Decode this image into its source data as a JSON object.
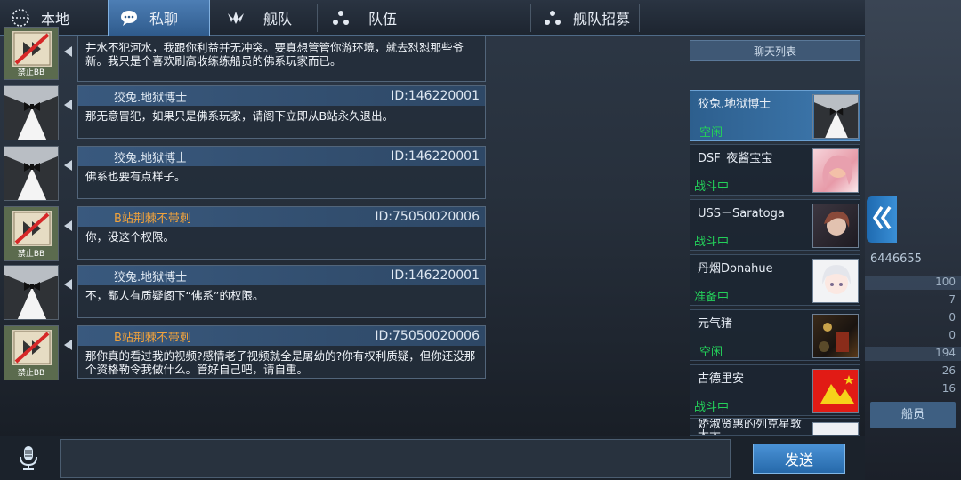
{
  "tabs": [
    {
      "label": "本地",
      "icon": "globe-icon"
    },
    {
      "label": "私聊",
      "icon": "chat-bubble-icon",
      "active": true
    },
    {
      "label": "舰队",
      "icon": "fleet-wing-icon"
    },
    {
      "label": "队伍",
      "icon": "team-dots-icon"
    },
    {
      "label": "舰队招募",
      "icon": "recruit-dots-icon"
    }
  ],
  "messages": [
    {
      "avatar": "banned",
      "avatar_label": "禁止BB",
      "name": "",
      "id": "",
      "text": "井水不犯河水，我跟你利益并无冲突。要真想管管你游环境，就去怼怼那些爷新。我只是个喜欢刷高收练练船员的佛系玩家而已。"
    },
    {
      "avatar": "tux",
      "name": "狡兔.地狱博士",
      "name_color": "white",
      "id": "ID:146220001",
      "text": "那无意冒犯，如果只是佛系玩家，请阁下立即从B站永久退出。"
    },
    {
      "avatar": "tux",
      "name": "狡兔.地狱博士",
      "name_color": "white",
      "id": "ID:146220001",
      "text": "佛系也要有点样子。"
    },
    {
      "avatar": "banned",
      "avatar_label": "禁止BB",
      "name": "B站荆棘不带刺",
      "name_color": "orange",
      "id": "ID:75050020006",
      "text": "你，没这个权限。"
    },
    {
      "avatar": "tux",
      "name": "狡兔.地狱博士",
      "name_color": "white",
      "id": "ID:146220001",
      "text": "不，鄙人有质疑阁下“佛系”的权限。"
    },
    {
      "avatar": "banned",
      "avatar_label": "禁止BB",
      "name": "B站荆棘不带刺",
      "name_color": "orange",
      "id": "ID:75050020006",
      "text": "那你真的看过我的视频?感情老子视频就全是屠幼的?你有权利质疑，但你还没那个资格勒令我做什么。管好自己吧，请自重。"
    }
  ],
  "chat_list": {
    "header": "聊天列表",
    "items": [
      {
        "name": "狡兔.地狱博士",
        "status": "空闲",
        "status_color": "#24d05a",
        "pic": "tuxedo",
        "selected": true
      },
      {
        "name": "DSF_夜酱宝宝",
        "status": "战斗中",
        "status_color": "#24d05a",
        "pic": "pink-anime"
      },
      {
        "name": "USS－Saratoga",
        "status": "战斗中",
        "status_color": "#24d05a",
        "pic": "dark-anime"
      },
      {
        "name": "丹烟Donahue",
        "status": "准备中",
        "status_color": "#24d05a",
        "pic": "white-anime"
      },
      {
        "name": "元气猪",
        "status": "空闲",
        "status_color": "#24d05a",
        "pic": "dark-photo"
      },
      {
        "name": "古德里安",
        "status": "战斗中",
        "status_color": "#24d05a",
        "pic": "red-flag"
      },
      {
        "name": "娇淑贤惠的列克星敦太太",
        "status": "",
        "status_color": "#24d05a",
        "pic": "light-anime"
      }
    ]
  },
  "input": {
    "value": "",
    "placeholder": ""
  },
  "send_label": "发送",
  "background": {
    "number": "6446655",
    "stats": [
      "100",
      "7",
      "0",
      "0",
      "194",
      "26",
      "16"
    ],
    "button": "船员"
  }
}
